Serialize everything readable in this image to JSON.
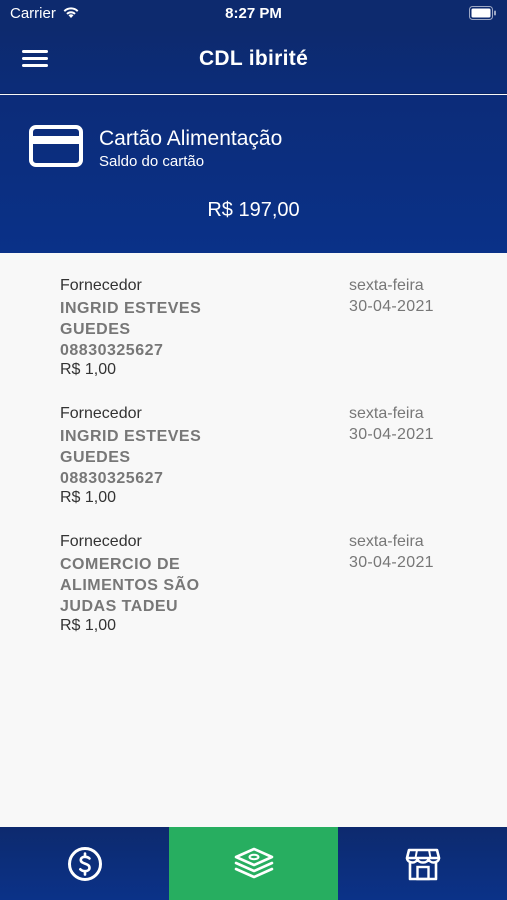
{
  "status_bar": {
    "carrier": "Carrier",
    "time": "8:27 PM"
  },
  "nav": {
    "title": "CDL ibirité",
    "menu_icon": "hamburger-menu-icon"
  },
  "card": {
    "icon": "credit-card-icon",
    "title": "Cartão Alimentação",
    "subtitle": "Saldo do cartão",
    "balance": "R$ 197,00"
  },
  "transactions": [
    {
      "label": "Fornecedor",
      "name_lines": [
        "INGRID ESTEVES",
        "GUEDES",
        "08830325627"
      ],
      "value": "R$ 1,00",
      "day": "sexta-feira",
      "date": "30-04-2021"
    },
    {
      "label": "Fornecedor",
      "name_lines": [
        "INGRID ESTEVES",
        "GUEDES",
        "08830325627"
      ],
      "value": "R$ 1,00",
      "day": "sexta-feira",
      "date": "30-04-2021"
    },
    {
      "label": "Fornecedor",
      "name_lines": [
        "COMERCIO DE",
        "ALIMENTOS SÃO",
        "JUDAS TADEU"
      ],
      "value": "R$ 1,00",
      "day": "sexta-feira",
      "date": "30-04-2021"
    }
  ],
  "tabs": [
    {
      "icon": "dollar-coin-icon",
      "active": false
    },
    {
      "icon": "money-stack-icon",
      "active": true
    },
    {
      "icon": "store-icon",
      "active": false
    }
  ],
  "colors": {
    "primary": "#0c2c79",
    "active_tab": "#27ae60",
    "muted_text": "#777777"
  }
}
